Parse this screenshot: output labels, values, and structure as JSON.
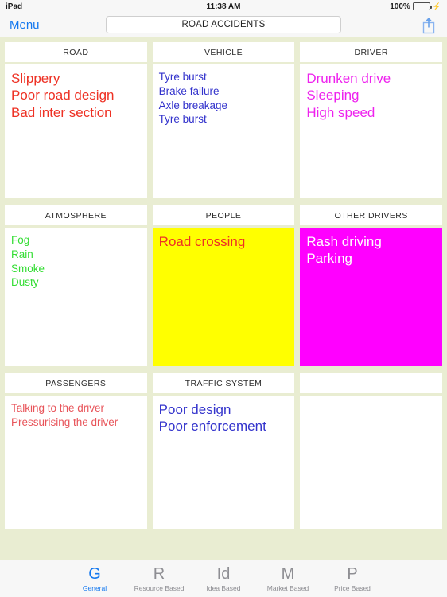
{
  "statusbar": {
    "device": "iPad",
    "time": "11:38 AM",
    "battery_percent": "100%",
    "battery_icon": "battery-icon",
    "charging_icon": "charging-bolt-icon"
  },
  "toolbar": {
    "menu_label": "Menu",
    "title_value": "ROAD ACCIDENTS",
    "title_placeholder": "Title",
    "share_icon": "share-icon"
  },
  "colors": {
    "background": "#e9edd2",
    "card": "#ffffff",
    "accent": "#1478ef",
    "red": "#ee3124",
    "soft_red": "#e8545a",
    "blue": "#3333cc",
    "magenta": "#ee22ee",
    "green": "#33dd33",
    "yellow_fill": "#ffff00",
    "magenta_fill": "#ff00ff",
    "yellow_text": "#ee3124",
    "magenta_text": "#ffffff"
  },
  "board": {
    "rows": [
      {
        "cards": [
          {
            "title": "ROAD",
            "fill": "#ffffff",
            "text_color": "#ee3124",
            "text_size": "large",
            "lines": [
              "Slippery",
              "Poor road design",
              "Bad inter section"
            ]
          },
          {
            "title": "VEHICLE",
            "fill": "#ffffff",
            "text_color": "#3333cc",
            "text_size": "small",
            "lines": [
              "Tyre burst",
              "Brake failure",
              "Axle breakage",
              "Tyre burst"
            ]
          },
          {
            "title": "DRIVER",
            "fill": "#ffffff",
            "text_color": "#ee22ee",
            "text_size": "large",
            "lines": [
              "Drunken drive",
              "Sleeping",
              "High speed"
            ]
          }
        ]
      },
      {
        "cards": [
          {
            "title": "ATMOSPHERE",
            "fill": "#ffffff",
            "text_color": "#33dd33",
            "text_size": "small",
            "lines": [
              "Fog",
              "Rain",
              "Smoke",
              "Dusty"
            ]
          },
          {
            "title": "PEOPLE",
            "fill": "#ffff00",
            "text_color": "#ee3124",
            "text_size": "large",
            "lines": [
              "Road crossing"
            ]
          },
          {
            "title": "OTHER DRIVERS",
            "fill": "#ff00ff",
            "text_color": "#ffffff",
            "text_size": "large",
            "lines": [
              "Rash driving",
              "Parking"
            ]
          }
        ]
      },
      {
        "cards": [
          {
            "title": "PASSENGERS",
            "fill": "#ffffff",
            "text_color": "#e8545a",
            "text_size": "small",
            "lines": [
              "Talking to the driver",
              "Pressurising the driver"
            ]
          },
          {
            "title": "TRAFFIC SYSTEM",
            "fill": "#ffffff",
            "text_color": "#3333cc",
            "text_size": "large",
            "lines": [
              "Poor design",
              "Poor enforcement"
            ]
          },
          {
            "title": "",
            "fill": "#ffffff",
            "text_color": "#000000",
            "text_size": "large",
            "lines": []
          }
        ]
      }
    ]
  },
  "tabbar": {
    "tabs": [
      {
        "glyph": "G",
        "label": "General",
        "active": true
      },
      {
        "glyph": "R",
        "label": "Resource Based",
        "active": false
      },
      {
        "glyph": "Id",
        "label": "Idea Based",
        "active": false
      },
      {
        "glyph": "M",
        "label": "Market Based",
        "active": false
      },
      {
        "glyph": "P",
        "label": "Price Based",
        "active": false
      }
    ]
  }
}
